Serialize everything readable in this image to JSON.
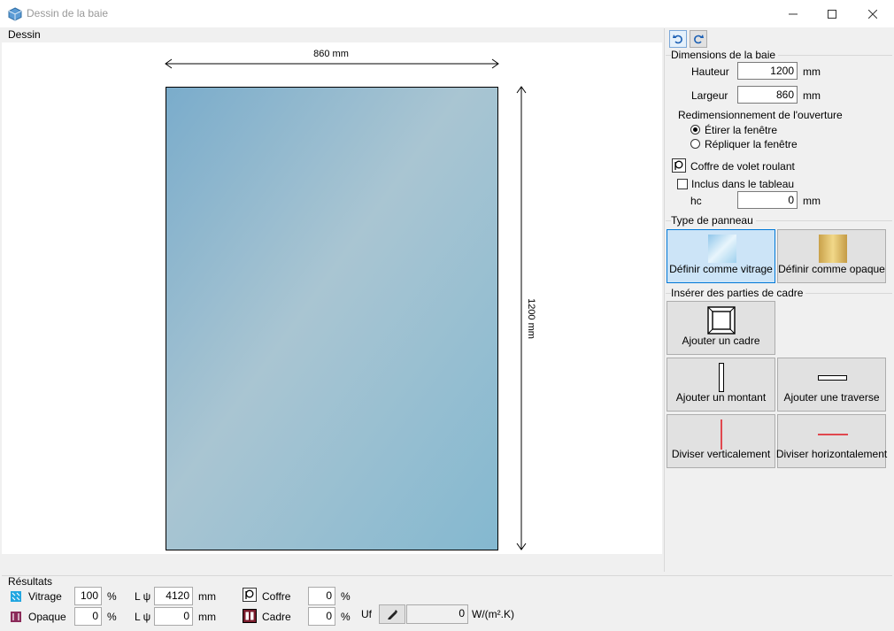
{
  "window": {
    "title": "Dessin de la baie",
    "controls": [
      "minimize",
      "maximize",
      "close"
    ]
  },
  "drawing": {
    "label": "Dessin",
    "width_dim": "860 mm",
    "height_dim": "1200 mm",
    "glass_colors": [
      "#7aaccb",
      "#a9c5d2",
      "#84b8d0"
    ]
  },
  "toolbar": {
    "undo_icon": "undo-icon",
    "redo_icon": "redo-icon"
  },
  "dimensions": {
    "title": "Dimensions de la baie",
    "hauteur_label": "Hauteur",
    "hauteur_value": "1200",
    "hauteur_unit": "mm",
    "largeur_label": "Largeur",
    "largeur_value": "860",
    "largeur_unit": "mm",
    "resize_title": "Redimensionnement de l'ouverture",
    "resize_options": [
      "Étirer la fenêtre",
      "Répliquer la fenêtre"
    ],
    "resize_selected": "Étirer la fenêtre",
    "coffre_label": "Coffre de volet roulant",
    "inclus_label": "Inclus dans le tableau",
    "hc_label": "hc",
    "hc_value": "0",
    "hc_unit": "mm"
  },
  "panel_type": {
    "title": "Type de panneau",
    "vitrage_label": "Définir comme vitrage",
    "opaque_label": "Définir comme opaque",
    "selected": "vitrage"
  },
  "frame_parts": {
    "title": "Insérer des parties de cadre",
    "ajouter_cadre": "Ajouter un cadre",
    "ajouter_montant": "Ajouter un montant",
    "ajouter_traverse": "Ajouter une traverse",
    "diviser_vert": "Diviser verticalement",
    "diviser_horiz": "Diviser horizontalement"
  },
  "results": {
    "title": "Résultats",
    "vitrage_label": "Vitrage",
    "vitrage_value": "100",
    "opaque_label": "Opaque",
    "opaque_value": "0",
    "percent": "%",
    "lpsi_label": "L ψ",
    "lpsi_1_value": "4120",
    "lpsi_2_value": "0",
    "mm": "mm",
    "coffre_label": "Coffre",
    "coffre_value": "0",
    "cadre_label": "Cadre",
    "cadre_value": "0",
    "uf_label": "Uf",
    "uf_value": "0",
    "uf_unit": "W/(m².K)"
  }
}
